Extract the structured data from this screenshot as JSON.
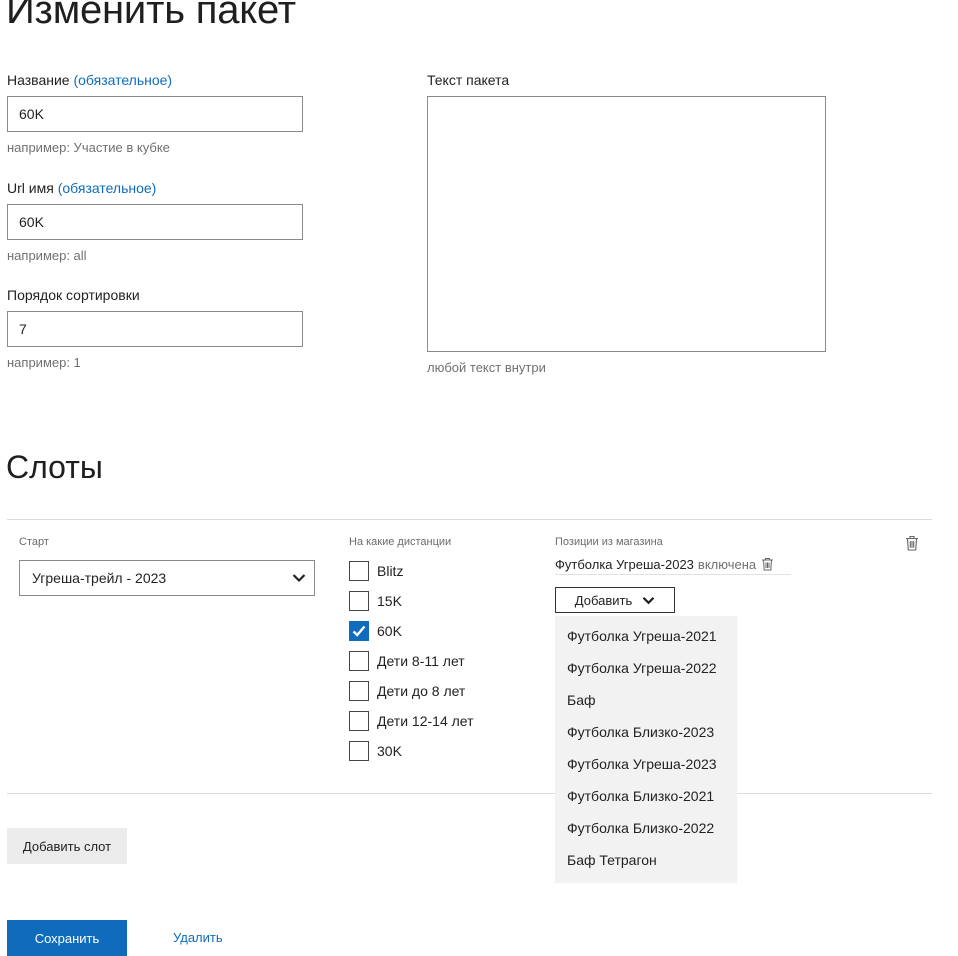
{
  "page_title": "Изменить пакет",
  "form": {
    "name": {
      "label": "Название",
      "required": "(обязательное)",
      "value": "60K",
      "hint": "например: Участие в кубке"
    },
    "url": {
      "label": "Url имя",
      "required": "(обязательное)",
      "value": "60K",
      "hint": "например: all"
    },
    "sort": {
      "label": "Порядок сортировки",
      "value": "7",
      "hint": "например: 1"
    },
    "text": {
      "label": "Текст пакета",
      "value": "",
      "hint": "любой текст внутри"
    }
  },
  "slots": {
    "title": "Слоты",
    "start": {
      "label": "Старт",
      "selected": "Угреша-трейл - 2023"
    },
    "distances": {
      "label": "На какие дистанции",
      "items": [
        {
          "label": "Blitz",
          "checked": false
        },
        {
          "label": "15K",
          "checked": false
        },
        {
          "label": "60K",
          "checked": true
        },
        {
          "label": "Дети 8-11 лет",
          "checked": false
        },
        {
          "label": "Дети до 8 лет",
          "checked": false
        },
        {
          "label": "Дети 12-14 лет",
          "checked": false
        },
        {
          "label": "30K",
          "checked": false
        }
      ]
    },
    "shop": {
      "label": "Позиции из магазина",
      "item_name": "Футболка Угреша-2023",
      "item_status": "включена",
      "add_label": "Добавить",
      "options": [
        "Футболка Угреша-2021",
        "Футболка Угреша-2022",
        "Баф",
        "Футболка Близко-2023",
        "Футболка Угреша-2023",
        "Футболка Близко-2021",
        "Футболка Близко-2022",
        "Баф Тетрагон"
      ]
    },
    "add_slot_label": "Добавить слот"
  },
  "actions": {
    "save_label": "Сохранить",
    "delete_label": "Удалить"
  },
  "colors": {
    "accent": "#0f6cbd",
    "menu_bg": "#f2f2f2",
    "button_bg": "#ebebeb"
  }
}
